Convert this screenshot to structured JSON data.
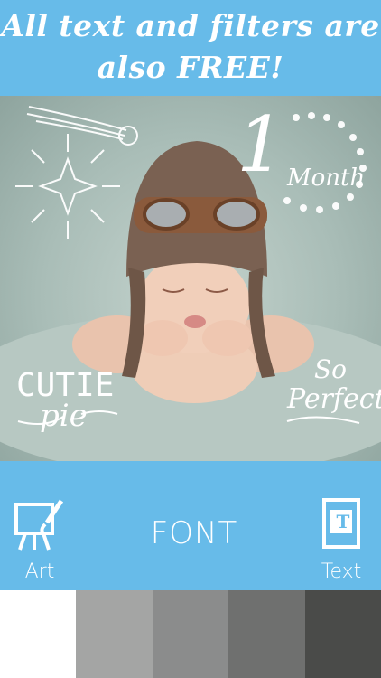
{
  "banner": {
    "line1": "All text and filters are",
    "line2": "also FREE!"
  },
  "photo": {
    "stickers": {
      "month_number": "1",
      "month_word": "Month",
      "cutie": "CUTIE",
      "pie": "pie",
      "so": "So",
      "perfect": "Perfect"
    }
  },
  "toolbar": {
    "art_label": "Art",
    "font_label": "FONT",
    "text_label": "Text",
    "text_icon_glyph": "T"
  },
  "swatches": [
    {
      "color": "#ffffff"
    },
    {
      "color": "#a4a5a4"
    },
    {
      "color": "#8b8c8c"
    },
    {
      "color": "#6f706f"
    },
    {
      "color": "#4a4b49"
    }
  ],
  "colors": {
    "accent": "#67bbe9"
  }
}
